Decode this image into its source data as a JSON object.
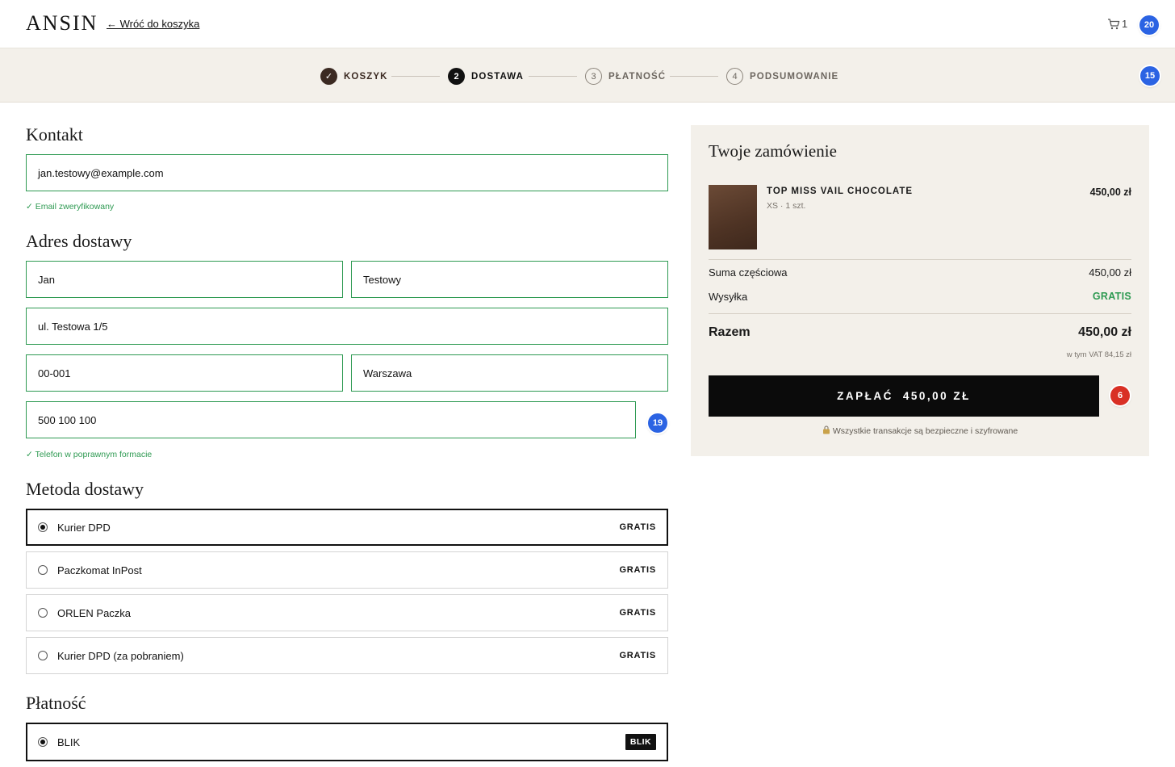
{
  "header": {
    "logo": "ANSIN",
    "back_link": "← Wróć do koszyka",
    "cart_count": "1",
    "badge_top": "20"
  },
  "steps": {
    "items": [
      {
        "num": "✓",
        "label": "KOSZYK",
        "state": "done"
      },
      {
        "num": "2",
        "label": "DOSTAWA",
        "state": "active"
      },
      {
        "num": "3",
        "label": "PŁATNOŚĆ",
        "state": "todo"
      },
      {
        "num": "4",
        "label": "PODSUMOWANIE",
        "state": "todo"
      }
    ],
    "badge": "15"
  },
  "contact": {
    "heading": "Kontakt",
    "email": "jan.testowy@example.com",
    "email_ok": "✓ Email zweryfikowany"
  },
  "address": {
    "heading": "Adres dostawy",
    "first_name": "Jan",
    "last_name": "Testowy",
    "street": "ul. Testowa 1/5",
    "postal_code": "00-001",
    "city": "Warszawa",
    "phone": "500 100 100",
    "phone_badge": "19",
    "phone_ok": "✓ Telefon w poprawnym formacie"
  },
  "shipping": {
    "heading": "Metoda dostawy",
    "options": [
      {
        "name": "Kurier DPD",
        "price": "GRATIS",
        "selected": true
      },
      {
        "name": "Paczkomat InPost",
        "price": "GRATIS",
        "selected": false
      },
      {
        "name": "ORLEN Paczka",
        "price": "GRATIS",
        "selected": false
      },
      {
        "name": "Kurier DPD (za pobraniem)",
        "price": "GRATIS",
        "selected": false
      }
    ]
  },
  "payment": {
    "heading": "Płatność",
    "option": {
      "name": "BLIK",
      "logo": "BLIK",
      "selected": true
    }
  },
  "summary": {
    "title": "Twoje zamówienie",
    "product": {
      "name": "TOP MISS VAIL CHOCOLATE",
      "meta": "XS · 1 szt.",
      "price": "450,00 zł"
    },
    "subtotal_label": "Suma częściowa",
    "subtotal_value": "450,00 zł",
    "shipping_label": "Wysyłka",
    "shipping_value": "GRATIS",
    "total_label": "Razem",
    "total_value": "450,00 zł",
    "vat": "w tym VAT 84,15 zł",
    "pay_label": "ZAPŁAĆ",
    "pay_amount": "450,00 ZŁ",
    "pay_badge": "6",
    "secure_note": "Wszystkie transakcje są bezpieczne i szyfrowane"
  },
  "colors": {
    "accent_green": "#2e9a52",
    "beige_panel": "#f3f0ea",
    "badge_blue": "#2b63e3",
    "badge_red": "#d93025",
    "button_black": "#0b0b0b"
  }
}
